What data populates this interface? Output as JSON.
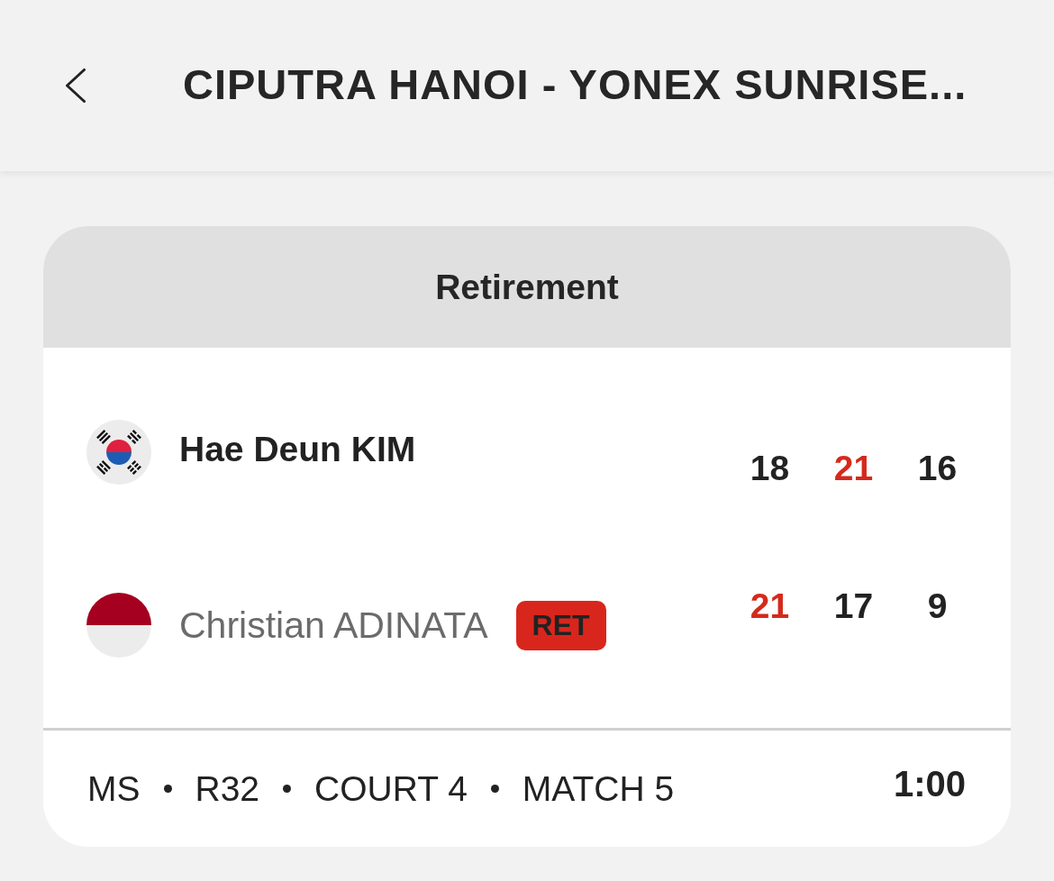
{
  "header": {
    "title": "CIPUTRA HANOI - YONEX SUNRISE..."
  },
  "match": {
    "status": "Retirement",
    "players": [
      {
        "name": "Hae Deun KIM",
        "flag": {
          "kind": "korea"
        },
        "winner": true,
        "scores": [
          {
            "value": "18",
            "won": false
          },
          {
            "value": "21",
            "won": true
          },
          {
            "value": "16",
            "won": false
          }
        ]
      },
      {
        "name": "Christian ADINATA",
        "flag": {
          "kind": "indonesia"
        },
        "winner": false,
        "badge": "RET",
        "scores": [
          {
            "value": "21",
            "won": true
          },
          {
            "value": "17",
            "won": false
          },
          {
            "value": "9",
            "won": false
          }
        ]
      }
    ],
    "footer": {
      "details": [
        "MS",
        "R32",
        "COURT 4",
        "MATCH 5"
      ],
      "time": "1:00"
    }
  }
}
